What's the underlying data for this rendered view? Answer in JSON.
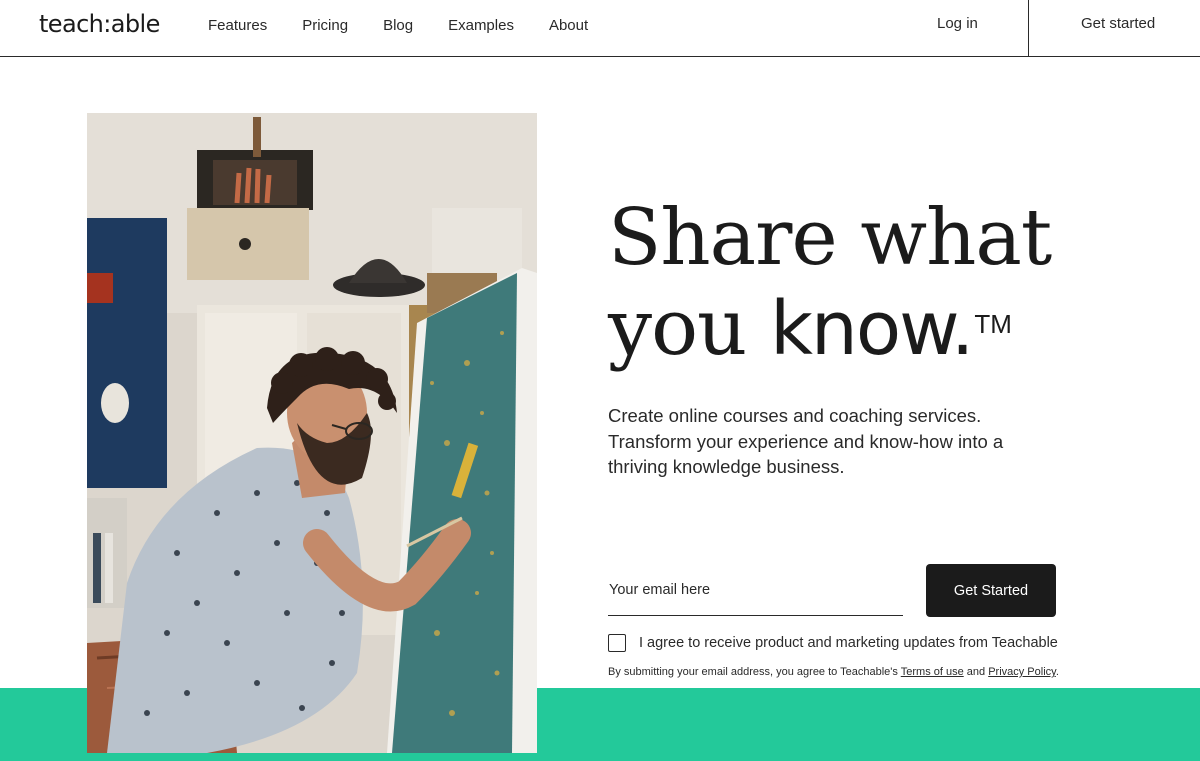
{
  "header": {
    "logo": "teach:able",
    "nav": [
      "Features",
      "Pricing",
      "Blog",
      "Examples",
      "About"
    ],
    "login": "Log in",
    "get_started": "Get started"
  },
  "hero": {
    "headline_line1": "Share what",
    "headline_line2_serif": "you ",
    "headline_line2_sans": "know.",
    "trademark": "TM",
    "subtext": "Create online courses and coaching services. Transform your experience and know-how into a thriving knowledge business.",
    "email_placeholder": "Your email here",
    "cta_label": "Get Started",
    "consent_label": "I agree to receive product and marketing updates from Teachable",
    "legal_prefix": "By submitting your email address, you agree to Teachable's ",
    "terms_label": "Terms of use",
    "legal_and": " and ",
    "privacy_label": "Privacy Policy",
    "legal_suffix": "."
  },
  "colors": {
    "brand_green": "#23c99a",
    "button_dark": "#1b1b1b"
  },
  "icons": [
    "checkbox-icon"
  ]
}
